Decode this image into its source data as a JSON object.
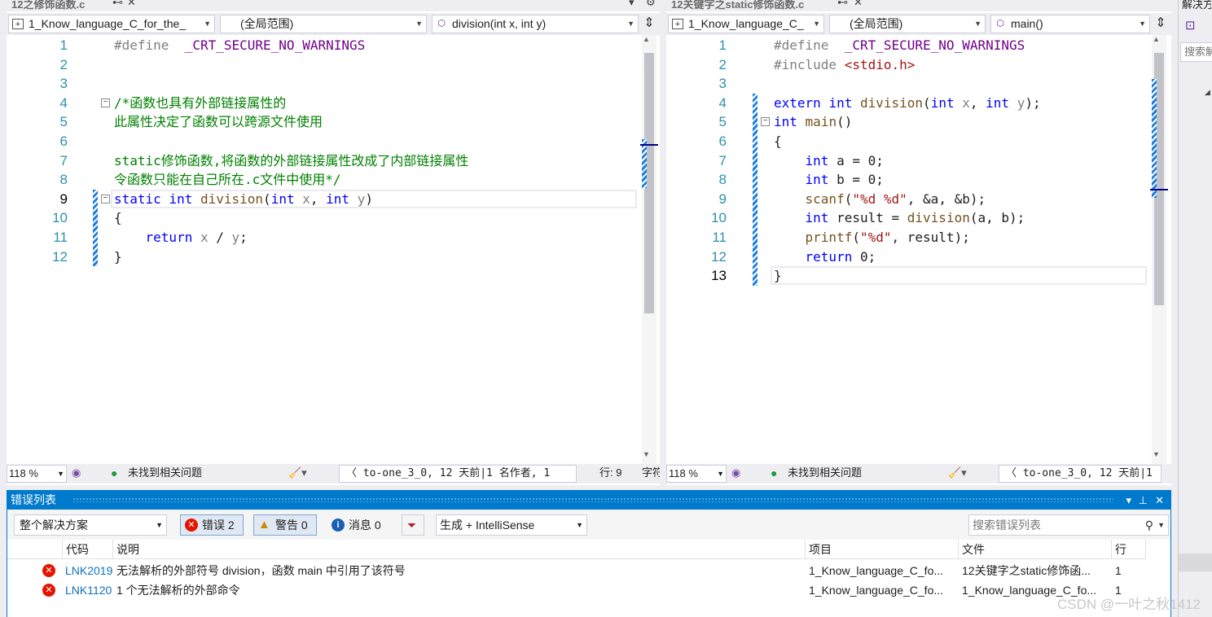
{
  "left_pane": {
    "tab_title": "12之修饰函数.c",
    "nav_project": "1_Know_language_C_for_the_",
    "nav_scope": "(全局范围)",
    "nav_member": "division(int x, int y)",
    "lines": [
      {
        "n": "1",
        "html": "<span class='pp'>#define</span>  <span class='mac'>_CRT_SECURE_NO_WARNINGS</span>"
      },
      {
        "n": "2",
        "html": ""
      },
      {
        "n": "3",
        "html": ""
      },
      {
        "n": "4",
        "html": "<span class='cm'>/*函数也具有外部链接属性的</span>"
      },
      {
        "n": "5",
        "html": "<span class='cm'>此属性决定了函数可以跨源文件使用</span>"
      },
      {
        "n": "6",
        "html": ""
      },
      {
        "n": "7",
        "html": "<span class='cm'>static修饰函数,将函数的外部链接属性改成了内部链接属性</span>"
      },
      {
        "n": "8",
        "html": "<span class='cm'>令函数只能在自己所在.c文件中使用*/</span>"
      },
      {
        "n": "9",
        "html": "<span class='kw'>static</span> <span class='kw'>int</span> <span class='fn'>division</span>(<span class='kw'>int</span> <span class='par'>x</span>, <span class='kw'>int</span> <span class='par'>y</span>)"
      },
      {
        "n": "10",
        "html": "{"
      },
      {
        "n": "11",
        "html": "    <span class='kw'>return</span> <span class='par'>x</span> / <span class='par'>y</span>;"
      },
      {
        "n": "12",
        "html": "}"
      }
    ],
    "current_line": "9",
    "zoom": "118 %",
    "issues": "未找到相关问题",
    "git_info": "to-one_3_0, 12 天前|1 名作者, 1",
    "position": "行: 9",
    "encoding_hint": "字符"
  },
  "right_pane": {
    "tab_title": "12关键字之static修饰函数.c",
    "nav_project": "1_Know_language_C_",
    "nav_scope": "(全局范围)",
    "nav_member": "main()",
    "lines": [
      {
        "n": "1",
        "html": "<span class='pp'>#define</span>  <span class='mac'>_CRT_SECURE_NO_WARNINGS</span>"
      },
      {
        "n": "2",
        "html": "<span class='pp'>#include</span> <span class='str'>&lt;stdio.h&gt;</span>"
      },
      {
        "n": "3",
        "html": ""
      },
      {
        "n": "4",
        "html": "<span class='kw'>extern</span> <span class='kw'>int</span> <span class='fn'>division</span>(<span class='kw'>int</span> <span class='par'>x</span>, <span class='kw'>int</span> <span class='par'>y</span>);"
      },
      {
        "n": "5",
        "html": "<span class='kw'>int</span> <span class='fn'>main</span>()"
      },
      {
        "n": "6",
        "html": "{"
      },
      {
        "n": "7",
        "html": "    <span class='kw'>int</span> a = 0;"
      },
      {
        "n": "8",
        "html": "    <span class='kw'>int</span> b = 0;"
      },
      {
        "n": "9",
        "html": "    <span class='fn'>scanf</span>(<span class='str'>\"%d %d\"</span>, &amp;a, &amp;b);"
      },
      {
        "n": "10",
        "html": "    <span class='kw'>int</span> result = <span class='fn'>division</span>(a, b);"
      },
      {
        "n": "11",
        "html": "    <span class='fn'>printf</span>(<span class='str'>\"%d\"</span>, result);"
      },
      {
        "n": "12",
        "html": "    <span class='kw'>return</span> 0;"
      },
      {
        "n": "13",
        "html": "}"
      }
    ],
    "current_line": "13",
    "zoom": "118 %",
    "issues": "未找到相关问题",
    "git_info": "to-one_3_0, 12 天前|1"
  },
  "error_list": {
    "title": "错误列表",
    "scope": "整个解决方案",
    "errors_btn": "错误 2",
    "warnings_btn": "警告 0",
    "messages_btn": "消息 0",
    "build_filter": "生成 + IntelliSense",
    "search_placeholder": "搜索错误列表",
    "columns": {
      "code": "代码",
      "desc": "说明",
      "project": "项目",
      "file": "文件",
      "line": "行"
    },
    "rows": [
      {
        "code": "LNK2019",
        "desc": "无法解析的外部符号 division，函数 main 中引用了该符号",
        "project": "1_Know_language_C_fo...",
        "file": "12关键字之static修饰函...",
        "line": "1"
      },
      {
        "code": "LNK1120",
        "desc": "1 个无法解析的外部命令",
        "project": "1_Know_language_C_fo...",
        "file": "1_Know_language_C_fo...",
        "line": "1"
      }
    ]
  },
  "right_strip": {
    "title": "解决方",
    "search": "搜索解"
  },
  "watermark": "CSDN @一叶之秋1412"
}
